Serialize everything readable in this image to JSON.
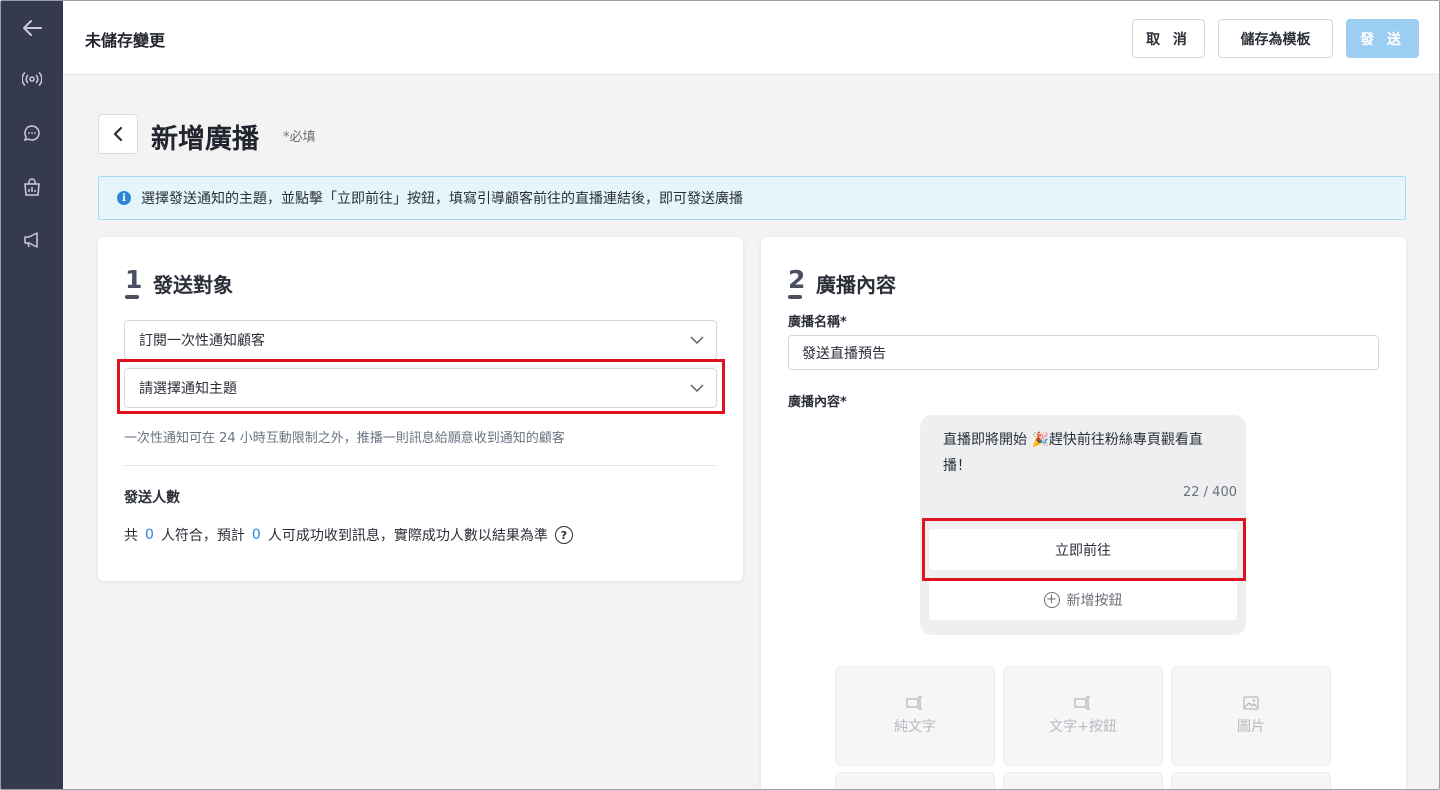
{
  "topbar": {
    "title": "未儲存變更",
    "cancel_label": "取 消",
    "save_template_label": "儲存為模板",
    "send_label": "發 送"
  },
  "page": {
    "title": "新增廣播",
    "required_note": "*必填"
  },
  "info": {
    "text": "選擇發送通知的主題，並點擊「立即前往」按鈕，填寫引導顧客前往的直播連結後，即可發送廣播"
  },
  "audience": {
    "step_number": "1",
    "step_title": "發送對象",
    "audience_select": "訂閱一次性通知顧客",
    "topic_select_placeholder": "請選擇通知主題",
    "hint": "一次性通知可在 24 小時互動限制之外，推播一則訊息給願意收到通知的顧客",
    "count_label": "發送人數",
    "count_prefix": "共",
    "matched_count": "0",
    "count_mid": "人符合，預計",
    "expected_count": "0",
    "count_suffix": "人可成功收到訊息，實際成功人數以結果為準",
    "help_symbol": "?"
  },
  "content": {
    "step_number": "2",
    "step_title": "廣播內容",
    "name_label": "廣播名稱*",
    "name_value": "發送直播預告",
    "content_label": "廣播內容*",
    "message_text": "直播即將開始 🎉趕快前往粉絲專頁觀看直播！",
    "char_count": "22 / 400",
    "go_button": "立即前往",
    "add_button": "新增按鈕",
    "types": [
      "純文字",
      "文字+按鈕",
      "圖片"
    ]
  },
  "colors": {
    "sidebar": "#363a4f",
    "accent": "#2d86d6",
    "send_button": "#9ccdf3",
    "highlight": "#e0121f",
    "info_bg": "#e4f6fc"
  },
  "icons": {
    "sidebar": [
      "back-arrow-icon",
      "broadcast-icon",
      "chat-icon",
      "shop-analytics-icon",
      "megaphone-icon"
    ]
  }
}
